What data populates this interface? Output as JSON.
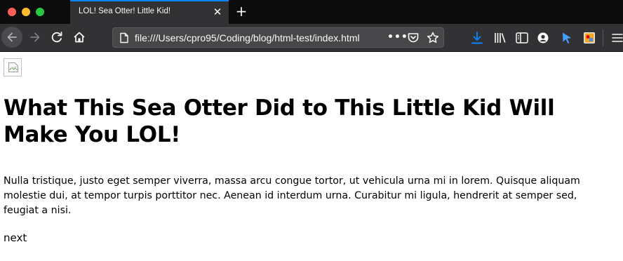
{
  "browser": {
    "tab": {
      "title": "LOL! Sea Otter! Little Kid!"
    },
    "address_bar": {
      "url": "file:///Users/cpro95/Coding/blog/html-test/index.html"
    },
    "icons": {
      "back": "back-arrow-icon",
      "forward": "forward-arrow-icon",
      "reload": "reload-icon",
      "home": "home-icon",
      "page": "page-icon",
      "more": "more-actions-icon",
      "pocket": "pocket-icon",
      "bookmark": "bookmark-star-icon",
      "downloads": "download-icon",
      "library": "library-icon",
      "sidebar": "sidebar-icon",
      "account": "account-icon",
      "cursor": "cursor-icon",
      "extension": "extension-icon",
      "menu": "hamburger-menu-icon"
    },
    "colors": {
      "tabstrip": "#0c0c0d",
      "toolbar": "#323234",
      "urlbar": "#474749",
      "accent": "#0a84ff"
    }
  },
  "page": {
    "image_icon": "broken-image-icon",
    "headline": "What This Sea Otter Did to This Little Kid Will Make You LOL!",
    "paragraph": "Nulla tristique, justo eget semper viverra, massa arcu congue tortor, ut vehicula urna mi in lorem. Quisque aliquam molestie dui, at tempor turpis porttitor nec. Aenean id interdum urna. Curabitur mi ligula, hendrerit at semper sed, feugiat a nisi.",
    "next_link": "next"
  }
}
